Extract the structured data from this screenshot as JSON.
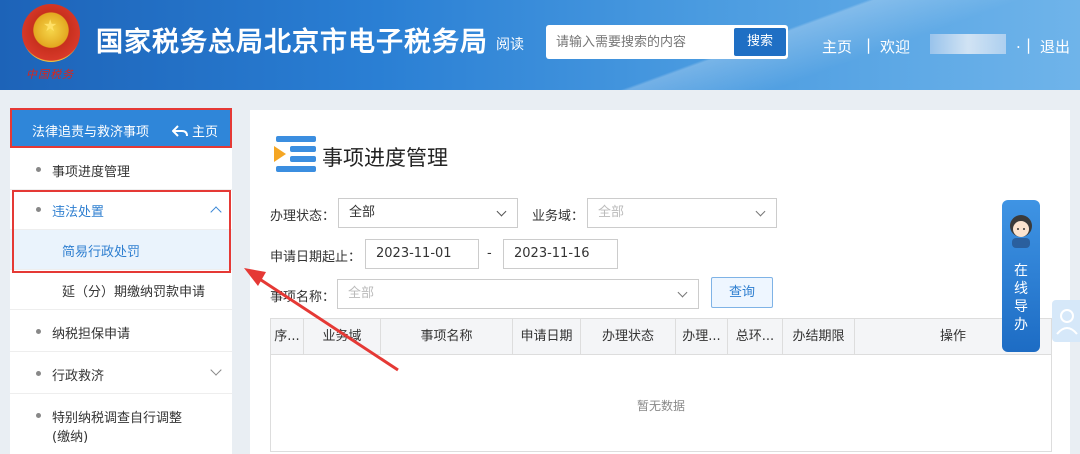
{
  "header": {
    "emblem_text": "中国税务",
    "site_title": "国家税务总局北京市电子税务局",
    "read_link": "阅读",
    "search_placeholder": "请输入需要搜索的内容",
    "search_button": "搜索",
    "nav_home": "主页",
    "separator": "|",
    "welcome": "欢迎",
    "dot": ".",
    "logout": "退出"
  },
  "sidebar": {
    "header_title": "法律追责与救济事项",
    "header_home": "主页",
    "items": [
      {
        "label": "事项进度管理"
      },
      {
        "label": "违法处置"
      },
      {
        "label": "简易行政处罚"
      },
      {
        "label": "延（分）期缴纳罚款申请"
      },
      {
        "label": "纳税担保申请"
      },
      {
        "label": "行政救济"
      },
      {
        "label": "特别纳税调查自行调整"
      },
      {
        "label": "(缴纳)"
      }
    ]
  },
  "main": {
    "title": "事项进度管理",
    "filters": {
      "status_label": "办理状态：",
      "status_value": "全部",
      "domain_label": "业务域：",
      "domain_value": "全部",
      "date_label": "申请日期起止：",
      "date_start": "2023-11-01",
      "date_sep": "-",
      "date_end": "2023-11-16",
      "item_label": "事项名称：",
      "item_value": "全部",
      "query_button": "查询"
    },
    "table": {
      "columns": [
        "序...",
        "业务域",
        "事项名称",
        "申请日期",
        "办理状态",
        "办理...",
        "总环...",
        "办结期限",
        "操作"
      ],
      "empty_text": "暂无数据"
    }
  },
  "guide": {
    "text": [
      "在",
      "线",
      "导",
      "办"
    ]
  }
}
